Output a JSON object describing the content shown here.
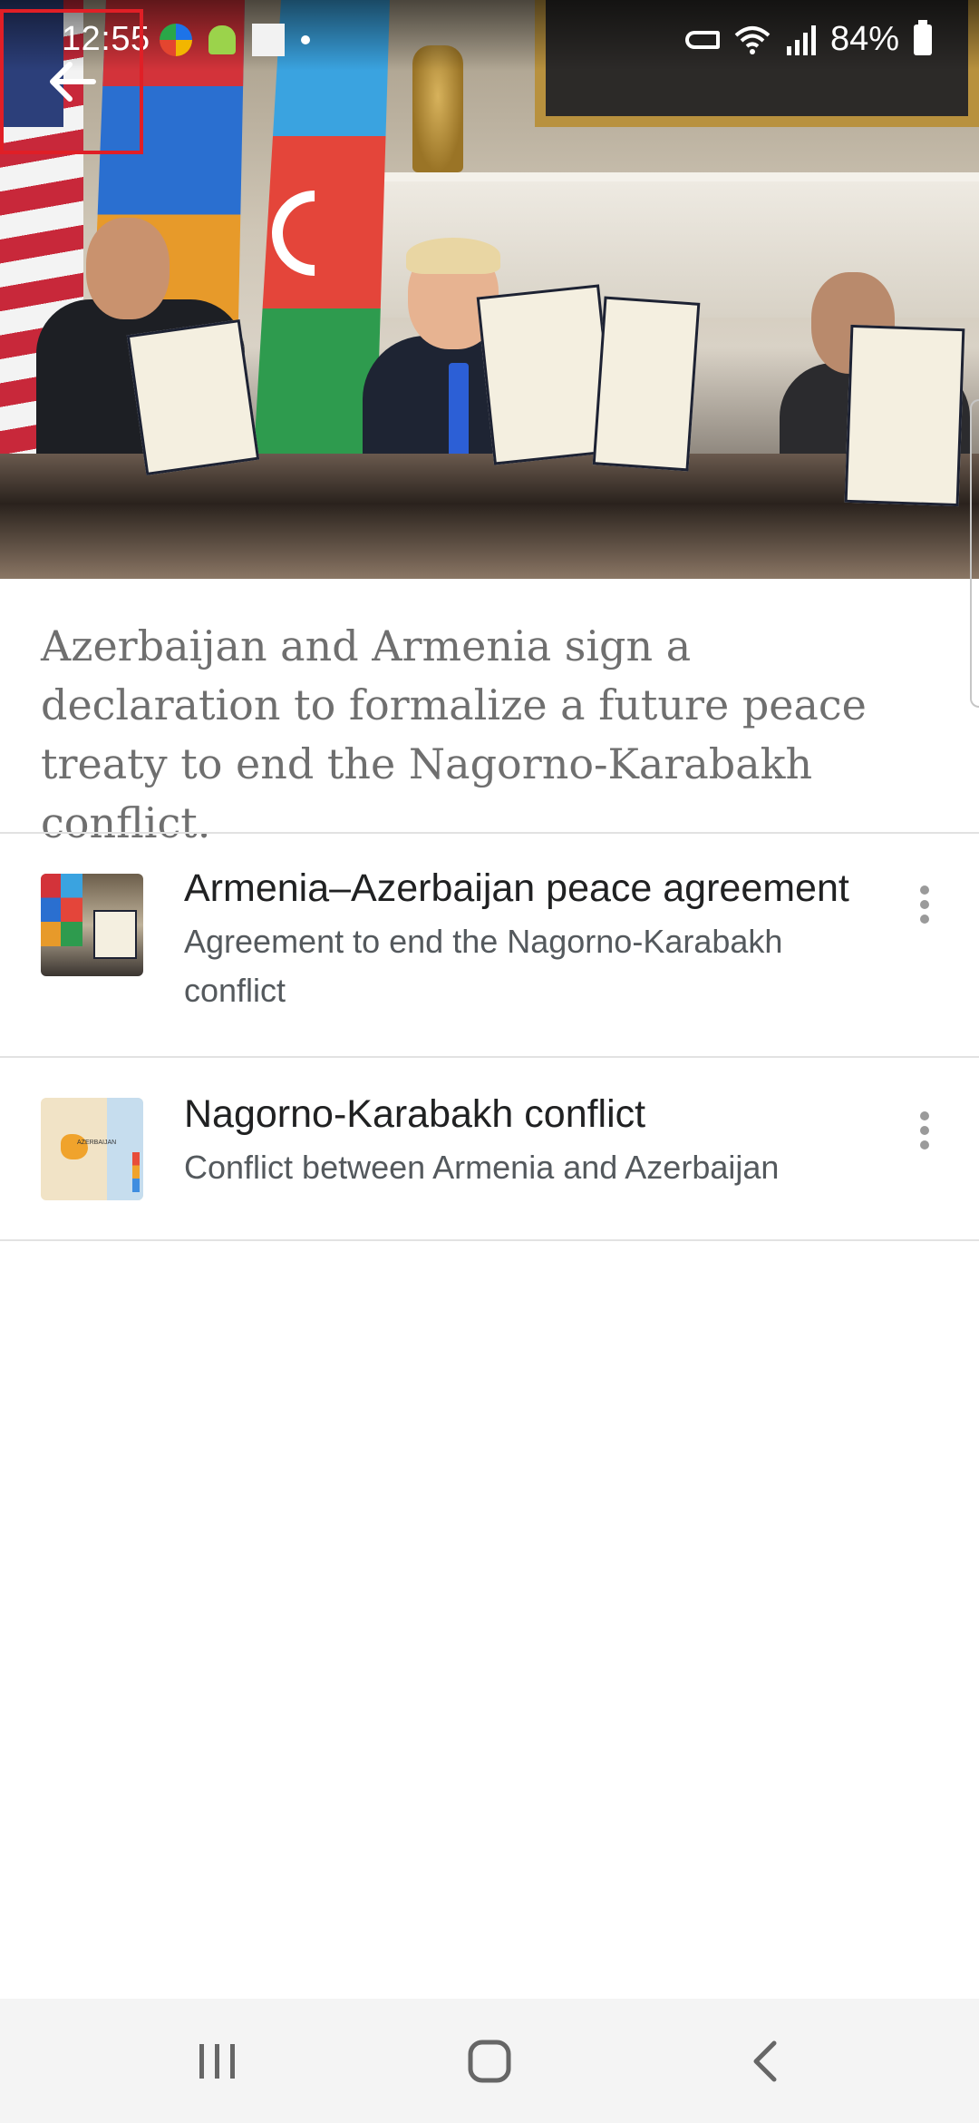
{
  "status_bar": {
    "time": "12:55",
    "battery": "84%",
    "icons_left": [
      "browser-icon",
      "android-icon",
      "square-notification-icon",
      "dot-icon"
    ],
    "icons_right": [
      "vpn-key-icon",
      "wifi-icon",
      "signal-icon",
      "battery-icon"
    ]
  },
  "hero": {
    "image": "signing-ceremony-photo"
  },
  "article": {
    "description": "Azerbaijan and Armenia sign a declaration to formalize a future peace treaty to end the Nagorno-Karabakh conflict."
  },
  "related": [
    {
      "title": "Armenia–Azerbaijan peace agreement",
      "subtitle": "Agreement to end the Nagorno-Karabakh conflict",
      "thumbnail": "signing-photo-thumbnail"
    },
    {
      "title": "Nagorno-Karabakh conflict",
      "subtitle": "Conflict between Armenia and Azerbaijan",
      "thumbnail": "map-thumbnail",
      "map_label": "AZERBAIJAN"
    }
  ],
  "navigation": {
    "buttons": [
      "recents",
      "home",
      "back"
    ]
  },
  "colors": {
    "highlight": "#e01f26",
    "description_text": "#6f6f6f",
    "title_text": "#202122",
    "subtitle_text": "#54595d",
    "nav_background": "#f4f4f4"
  }
}
